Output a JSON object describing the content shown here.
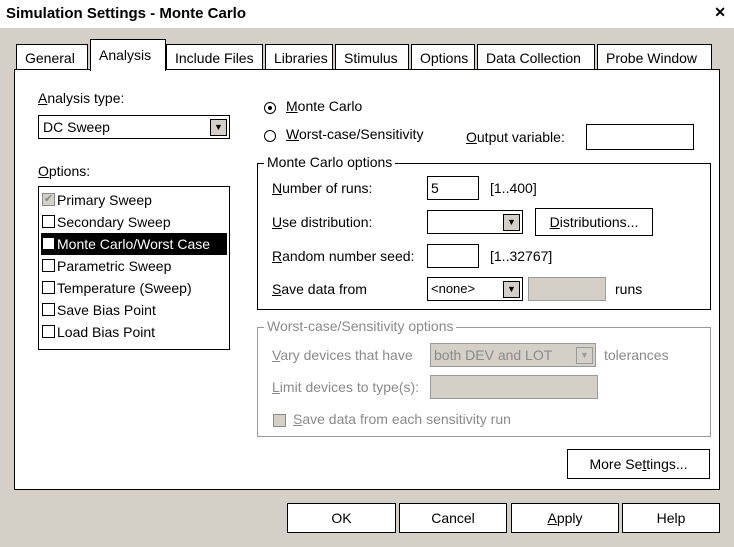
{
  "window": {
    "title": "Simulation Settings - Monte Carlo",
    "close_glyph": "✕"
  },
  "tabs": [
    {
      "label": "General"
    },
    {
      "label": "Analysis"
    },
    {
      "label": "Include Files"
    },
    {
      "label": "Libraries"
    },
    {
      "label": "Stimulus"
    },
    {
      "label": "Options"
    },
    {
      "label": "Data Collection"
    },
    {
      "label": "Probe Window"
    }
  ],
  "active_tab": "Analysis",
  "analysis_type": {
    "label_u": "A",
    "label_rest": "nalysis type:",
    "value": "DC Sweep"
  },
  "options": {
    "label_u": "O",
    "label_rest": "ptions:",
    "items": [
      {
        "label": "Primary Sweep",
        "checked": true,
        "disabled": true
      },
      {
        "label": "Secondary Sweep",
        "checked": false
      },
      {
        "label": "Monte Carlo/Worst Case",
        "checked": true,
        "selected": true
      },
      {
        "label": "Parametric Sweep",
        "checked": false
      },
      {
        "label": "Temperature (Sweep)",
        "checked": false
      },
      {
        "label": "Save Bias Point",
        "checked": false
      },
      {
        "label": "Load Bias Point",
        "checked": false
      }
    ]
  },
  "mode": {
    "monte_carlo_u": "M",
    "monte_carlo_rest": "onte Carlo",
    "worst_case_u": "W",
    "worst_case_rest": "orst-case/Sensitivity",
    "selected": "Monte Carlo",
    "output_variable_u": "O",
    "output_variable_rest": "utput variable:",
    "output_variable_value": ""
  },
  "monte_carlo_options": {
    "title": "Monte Carlo options",
    "runs_u": "N",
    "runs_rest": "umber of runs:",
    "runs_value": "5",
    "runs_range": "[1..400]",
    "dist_u": "U",
    "dist_rest": "se distribution:",
    "dist_value": "",
    "distributions_u": "D",
    "distributions_rest": "istributions...",
    "seed_u": "R",
    "seed_rest": "andom number seed:",
    "seed_value": "",
    "seed_range": "[1..32767]",
    "save_u": "S",
    "save_rest": "ave data from",
    "save_value": "<none>",
    "save_count": "",
    "runs_suffix": "runs"
  },
  "worst_case_options": {
    "title": "Worst-case/Sensitivity options",
    "vary_u": "V",
    "vary_rest": "ary devices that have",
    "vary_value": "both DEV and LOT",
    "tolerances": "tolerances",
    "limit_u": "L",
    "limit_rest": "imit devices to type(s):",
    "limit_value": "",
    "save_each_u": "S",
    "save_each_rest": "ave data from each sensitivity run"
  },
  "more_settings": {
    "pre": "More Se",
    "u": "t",
    "post": "tings..."
  },
  "buttons": {
    "ok": "OK",
    "cancel": "Cancel",
    "apply_u": "A",
    "apply_rest": "pply",
    "help": "Help"
  },
  "colors": {
    "face": "#d4d0c8",
    "window": "#ffffff",
    "text": "#000000",
    "disabled_text": "#8a8a8a",
    "selection": "#000000"
  }
}
